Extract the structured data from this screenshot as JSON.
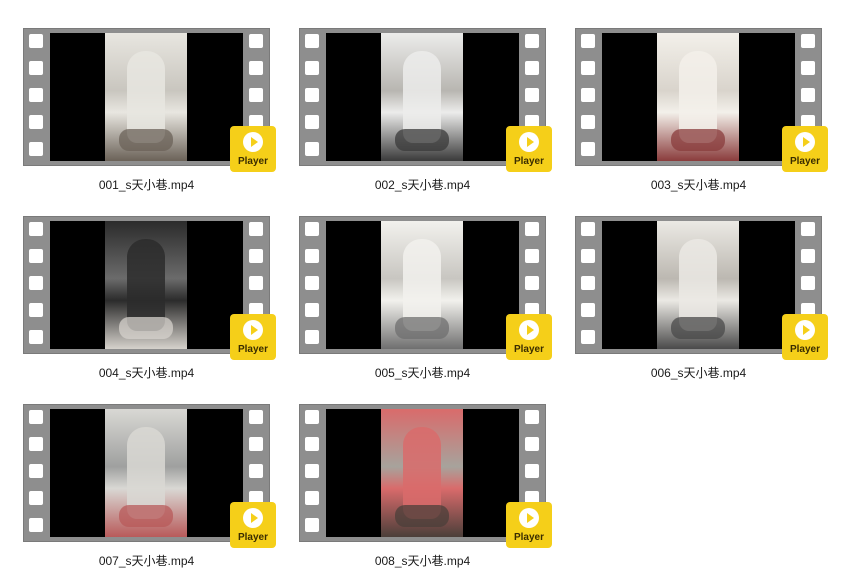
{
  "badge_label": "Player",
  "badge_color": "#f5cf19",
  "files": [
    {
      "name": "001_s天小巷.mp4",
      "scene": "wall-sock-sneaker",
      "tones": [
        "#c9c6bf",
        "#e8e6e0",
        "#6b6258"
      ]
    },
    {
      "name": "002_s天小巷.mp4",
      "scene": "foot-closeup-white",
      "tones": [
        "#b8b6b1",
        "#ececeb",
        "#3a3a3a"
      ]
    },
    {
      "name": "003_s天小巷.mp4",
      "scene": "room-socks-red",
      "tones": [
        "#d9d4cc",
        "#f3f0ea",
        "#8a3c3c"
      ]
    },
    {
      "name": "004_s天小巷.mp4",
      "scene": "dark-sock",
      "tones": [
        "#6b6b6b",
        "#2b2b2b",
        "#d6d2cc"
      ]
    },
    {
      "name": "005_s天小巷.mp4",
      "scene": "white-sock-print",
      "tones": [
        "#c8c6c1",
        "#f2f1ed",
        "#6f6f6f"
      ]
    },
    {
      "name": "006_s天小巷.mp4",
      "scene": "white-sock-window",
      "tones": [
        "#bcb8b1",
        "#ebe9e4",
        "#4a4a4a"
      ]
    },
    {
      "name": "007_s天小巷.mp4",
      "scene": "standing-window",
      "tones": [
        "#9fa09f",
        "#d9d8d4",
        "#b85a5a"
      ]
    },
    {
      "name": "008_s天小巷.mp4",
      "scene": "red-shoe-bed",
      "tones": [
        "#a7a39c",
        "#d96b6b",
        "#4b3f3a"
      ]
    }
  ]
}
